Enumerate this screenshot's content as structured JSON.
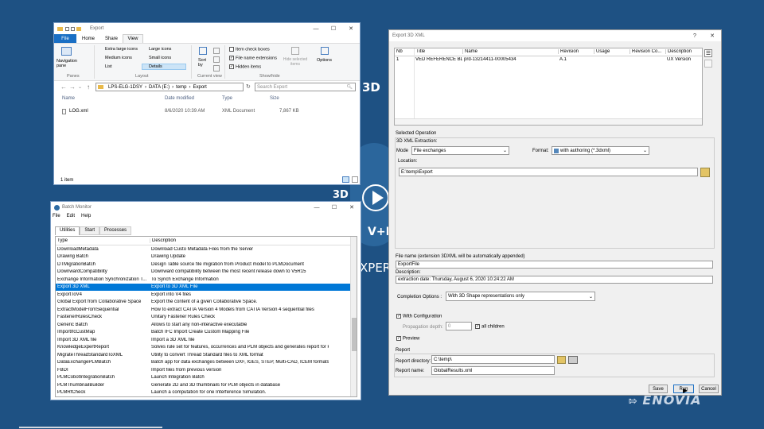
{
  "background": {
    "brand_3d": "3D",
    "brand_3d_small": "3D",
    "brand_vr": "V+R",
    "brand_xper": "XPER",
    "enovia": "ENOVIA"
  },
  "explorer": {
    "title": "Export",
    "ribbon_tabs": [
      "File",
      "Home",
      "Share",
      "View"
    ],
    "panes_label": "Navigation pane",
    "panes_group": "Panes",
    "layout_options": [
      "Extra large icons",
      "Large icons",
      "Medium icons",
      "Small icons",
      "List",
      "Details"
    ],
    "layout_group": "Layout",
    "sort_label": "Sort by",
    "current_view_group": "Current view",
    "show_options": [
      "Item check boxes",
      "File name extensions",
      "Hidden items"
    ],
    "hide_selected": "Hide selected items",
    "options_label": "Options",
    "showhide_group": "Show/hide",
    "breadcrumb": [
      "LPS-ELG-1DSY",
      "DATA (E:)",
      "temp",
      "Export"
    ],
    "search_placeholder": "Search Export",
    "columns": [
      "Name",
      "Date modified",
      "Type",
      "Size"
    ],
    "files": [
      {
        "name": "LOG.xml",
        "date": "8/6/2020 10:39 AM",
        "type": "XML Document",
        "size": "7,867 KB"
      }
    ],
    "status": "1 item"
  },
  "batch": {
    "title": "Batch Monitor",
    "menu": [
      "File",
      "Edit",
      "Help"
    ],
    "tabs": [
      "Utilities",
      "Start",
      "Processes"
    ],
    "columns": [
      "Type",
      "Description"
    ],
    "rows": [
      [
        "DownloadMetadata",
        "Download Custo Metadata Files from the Server"
      ],
      [
        "Drawing Batch",
        "Drawing Update"
      ],
      [
        "DTMigrationBatch",
        "Design Table source file migration from Product model to PLMDocument"
      ],
      [
        "DownwardCompatibility",
        "Downward compatibility between the most recent release down to V5R15"
      ],
      [
        "Exchange Information Synchronization T...",
        "To Synch Exchange Information"
      ],
      [
        "Export 3D XML",
        "Export to 3D XML File"
      ],
      [
        "ExportToV4",
        "Export into V4 files"
      ],
      [
        "Global Export from Collaborative Space",
        "Export the content of a given Collaborative Space."
      ],
      [
        "ExtractModelFromSequential",
        "How to extract CATIA Version 4 Models from CATIA Version 4 sequential files"
      ],
      [
        "FastenerRulesCheck",
        "Unitary Fastener Rules Check"
      ],
      [
        "Generic Batch",
        "Allows to start any non-interactive executable"
      ],
      [
        "ImportIfcCustMap",
        "Batch IFC Import Create Custom Mapping File"
      ],
      [
        "Import 3D XML file",
        "Import a 3D XML file"
      ],
      [
        "KnowledgeExpertReport",
        "Solves rule set for features, occurrences and PLM objects and generates report for k..."
      ],
      [
        "MigrateThreadStandardToXML",
        "Utility to convert Thread Standard files to XML format"
      ],
      [
        "DataExchangePLMBatch",
        "Batch app for data exchanges between DXF, IGES, STEP, Multi-CAD, ICEM formats a..."
      ],
      [
        "FBDI",
        "Import files from previous version"
      ],
      [
        "PLMCobotIntegrationBatch",
        "Launch Integration Batch"
      ],
      [
        "PLMThumbnailBuilder",
        "Generate 2D and 3D thumbnails for PLM objects in database"
      ],
      [
        "PLMRfCheck",
        "Launch a computation for one Interference Simulation."
      ]
    ],
    "selected_index": 5
  },
  "export": {
    "title": "Export 3D XML",
    "columns": [
      "Nb",
      "Title",
      "Name",
      "Revision",
      "Usage",
      "Revision Co...",
      "Description"
    ],
    "rows": [
      [
        "1",
        "VED REFERENCE BLE...",
        "prd-13214411-00005434",
        "A.1",
        "",
        "",
        "UX Version"
      ]
    ],
    "selected_operation": "Selected Operation",
    "extraction_label": "3D XML Extraction:",
    "mode_label": "Mode",
    "mode_value": "File exchanges",
    "format_label": "Format:",
    "format_value": "with authoring (*.3dxml)",
    "location_label": "Location:",
    "location_value": "E:\\temp\\Export",
    "filename_label": "File name (extension 3DXML will be automatically appended)",
    "filename_value": "ExportFile",
    "description_label": "Description:",
    "description_value": "extraction date: Thursday, August 6, 2020 10:24:22 AM",
    "completion_label": "Completion Options :",
    "completion_value": "With 3D Shape representations only",
    "with_config": "With Configuration",
    "propagation_label": "Propagation depth:",
    "propagation_value": "0",
    "all_children": "all children",
    "preview": "Preview",
    "report_group": "Report",
    "report_dir_label": "Report directory:",
    "report_dir_value": "C:\\temp\\",
    "report_name_label": "Report name:",
    "report_name_value": "GlobalResults.xml",
    "save": "Save",
    "run": "Run",
    "cancel": "Cancel"
  }
}
